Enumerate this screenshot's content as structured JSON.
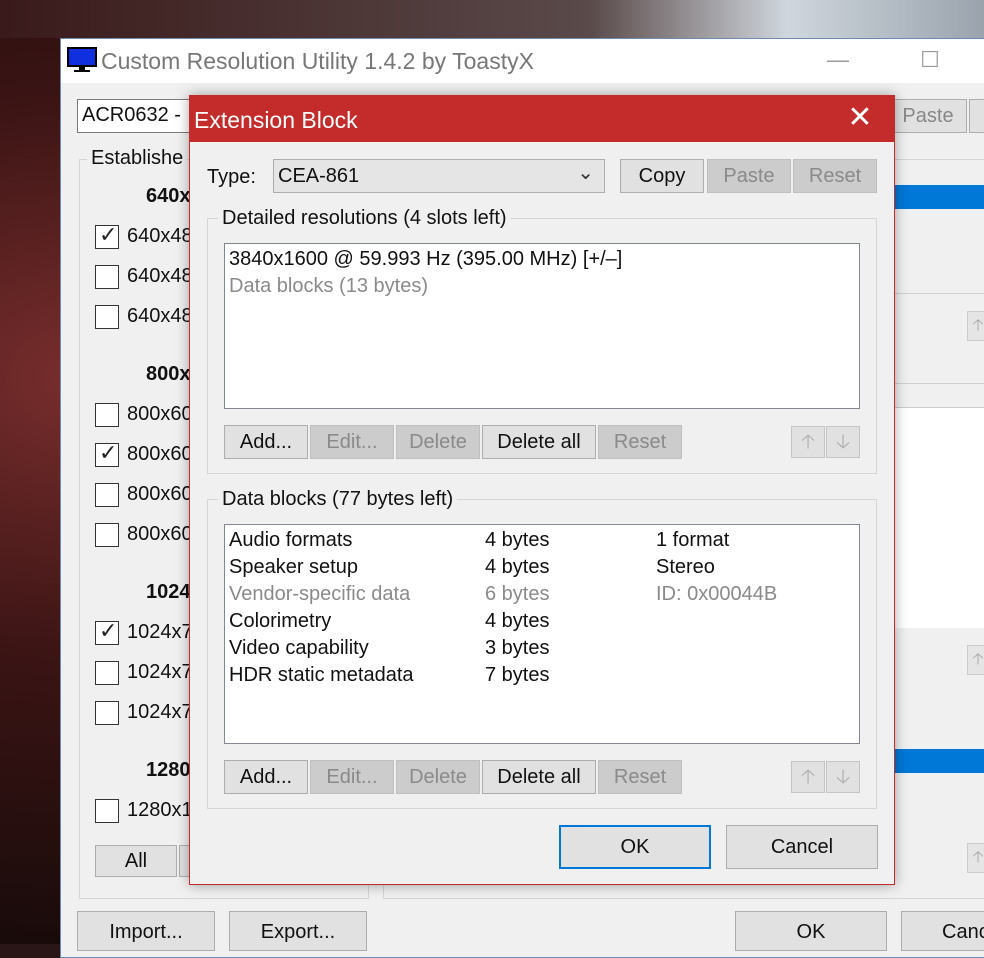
{
  "main_window": {
    "title": "Custom Resolution Utility 1.4.2 by ToastyX",
    "minimize_glyph": "—",
    "maximize_glyph": "☐",
    "monitor_combo": "ACR0632 - ",
    "paste_label": "Paste",
    "group_title": "Establishe",
    "sections": [
      {
        "header": "640x",
        "items": [
          {
            "label": "640x48",
            "checked": true
          },
          {
            "label": "640x48",
            "checked": false
          },
          {
            "label": "640x48",
            "checked": false
          }
        ]
      },
      {
        "header": "800x",
        "items": [
          {
            "label": "800x60",
            "checked": false
          },
          {
            "label": "800x60",
            "checked": true
          },
          {
            "label": "800x60",
            "checked": false
          },
          {
            "label": "800x60",
            "checked": false
          }
        ]
      },
      {
        "header": "1024",
        "items": [
          {
            "label": "1024x7",
            "checked": true
          },
          {
            "label": "1024x7",
            "checked": false
          },
          {
            "label": "1024x7",
            "checked": false
          }
        ]
      },
      {
        "header": "1280",
        "items": [
          {
            "label": "1280x1",
            "checked": false
          }
        ]
      }
    ],
    "all_label": "All",
    "import_label": "Import...",
    "export_label": "Export...",
    "ok_label": "OK",
    "cancel_label": "Canc"
  },
  "dialog": {
    "title": "Extension Block",
    "close_glyph": "✕",
    "type_label": "Type:",
    "type_value": "CEA-861",
    "copy_label": "Copy",
    "paste_label": "Paste",
    "reset_label": "Reset",
    "detailed": {
      "title": "Detailed resolutions (4 slots left)",
      "rows": [
        {
          "text": "3840x1600 @ 59.993 Hz (395.00 MHz) [+/–]",
          "gray": false
        },
        {
          "text": "Data blocks (13 bytes)",
          "gray": true
        }
      ],
      "buttons": {
        "add": "Add...",
        "edit": "Edit...",
        "delete": "Delete",
        "delete_all": "Delete all",
        "reset": "Reset"
      }
    },
    "data_blocks": {
      "title": "Data blocks (77 bytes left)",
      "rows": [
        {
          "name": "Audio formats",
          "size": "4 bytes",
          "info": "1 format",
          "gray": false
        },
        {
          "name": "Speaker setup",
          "size": "4 bytes",
          "info": "Stereo",
          "gray": false
        },
        {
          "name": "Vendor-specific data",
          "size": "6 bytes",
          "info": "ID: 0x00044B",
          "gray": true
        },
        {
          "name": "Colorimetry",
          "size": "4 bytes",
          "info": "",
          "gray": false
        },
        {
          "name": "Video capability",
          "size": "3 bytes",
          "info": "",
          "gray": false
        },
        {
          "name": "HDR static metadata",
          "size": "7 bytes",
          "info": "",
          "gray": false
        }
      ],
      "buttons": {
        "add": "Add...",
        "edit": "Edit...",
        "delete": "Delete",
        "delete_all": "Delete all",
        "reset": "Reset"
      }
    },
    "ok_label": "OK",
    "cancel_label": "Cancel"
  },
  "glyphs": {
    "up": "🡡",
    "down": "🡣",
    "check": "✓",
    "chevron": "⌄"
  }
}
